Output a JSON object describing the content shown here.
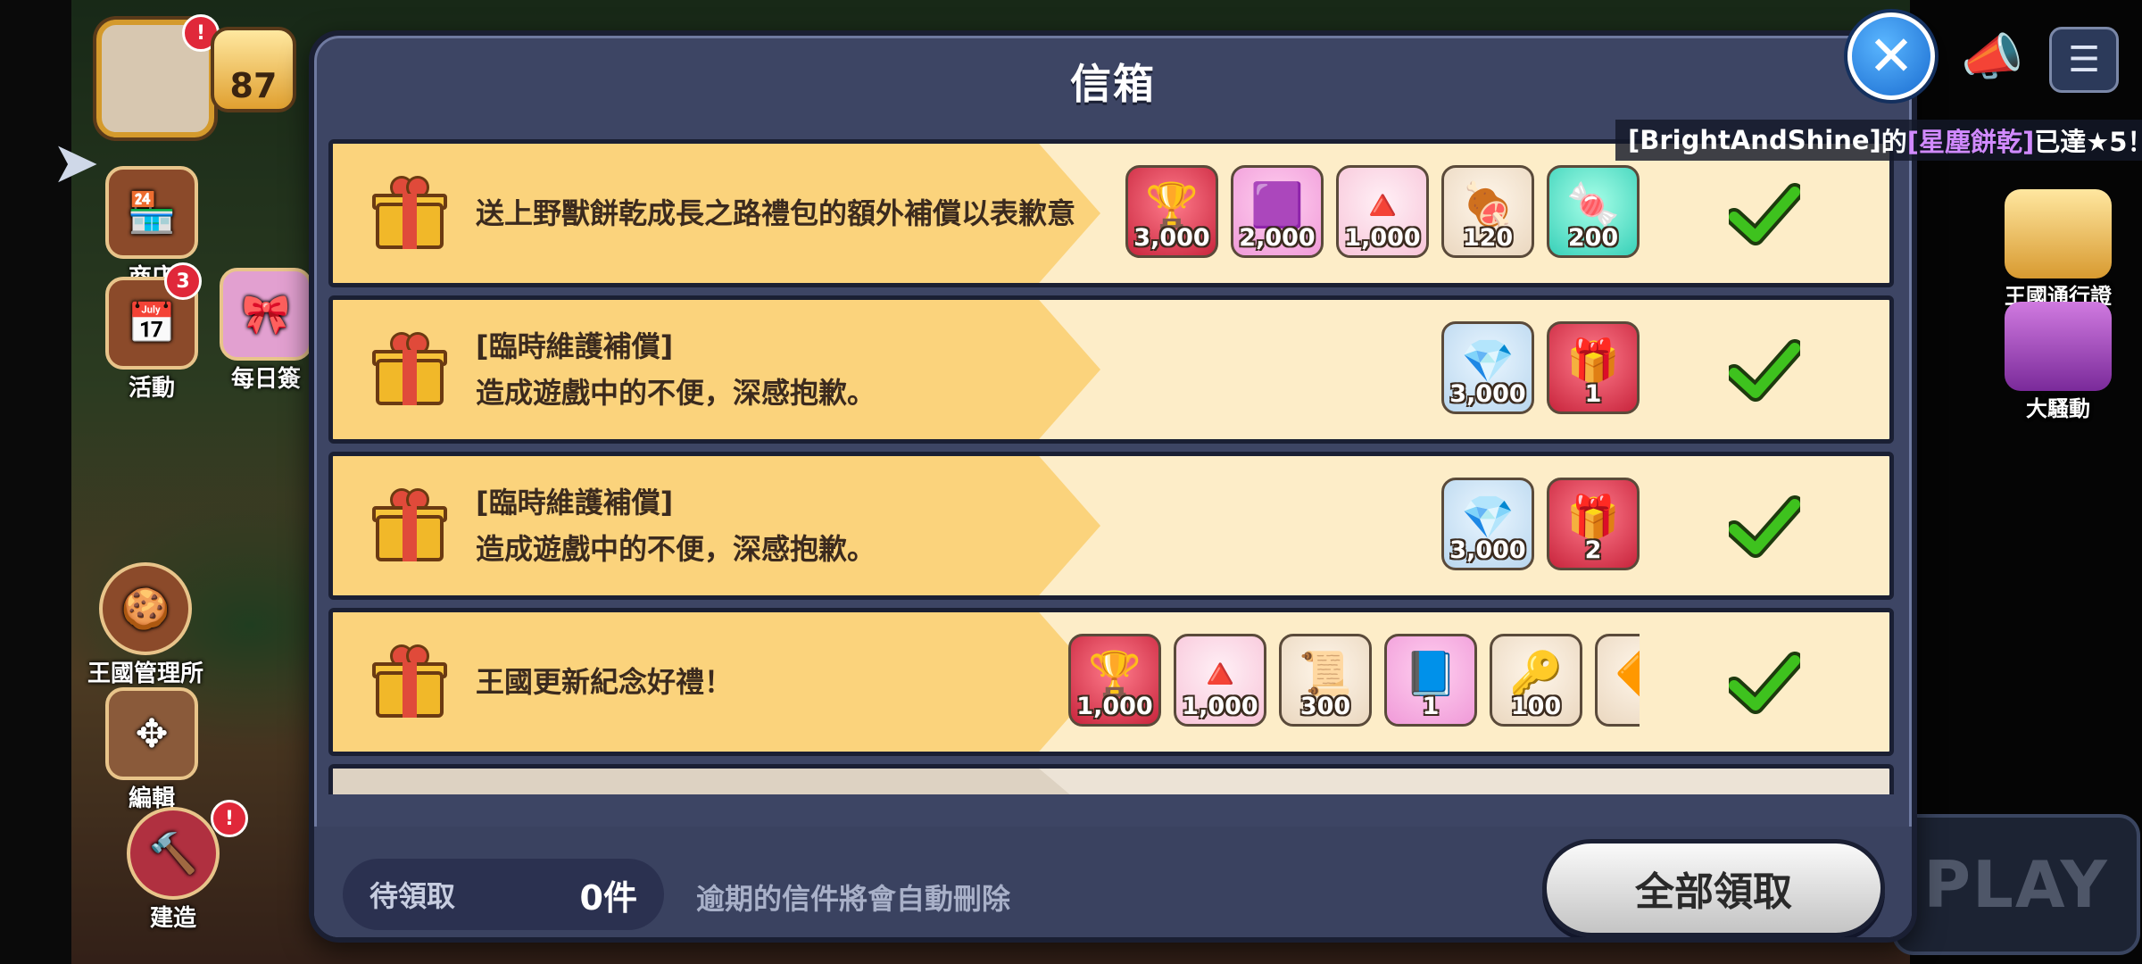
{
  "hud": {
    "level": "87",
    "shop_label": "商店",
    "events_label": "活動",
    "events_badge": "3",
    "daily_label": "每日簽",
    "kingdom_mgmt_label": "王國管理所",
    "edit_label": "編輯",
    "build_label": "建造",
    "kingdom_pass_label": "王國通行證",
    "commotion_label": "大騷動",
    "play_label": "PLAY",
    "alert_badge": "!"
  },
  "notice": {
    "player": "[BrightAndShine]",
    "mid": "的",
    "cookie": "[星塵餅乾]",
    "suffix": "已達★5！"
  },
  "mailbox": {
    "title": "信箱",
    "mails": [
      {
        "lines": [
          "送上野獸餅乾成長之路禮包的額外補償以表歉意"
        ],
        "rewards": [
          {
            "icon": "crystal-chest-icon",
            "glyph": "🏆",
            "bg": "red",
            "qty": "3,000"
          },
          {
            "icon": "rainbow-cube-icon",
            "glyph": "🟪",
            "bg": "purple",
            "qty": "2,000"
          },
          {
            "icon": "sugar-gnome-icon",
            "glyph": "🔺",
            "bg": "pink",
            "qty": "1,000"
          },
          {
            "icon": "meat-icon",
            "glyph": "🍖",
            "bg": "beige",
            "qty": "120"
          },
          {
            "icon": "jelly-icon",
            "glyph": "🍬",
            "bg": "teal",
            "qty": "200"
          }
        ]
      },
      {
        "lines": [
          "[臨時維護補償]",
          "造成遊戲中的不便，深感抱歉。"
        ],
        "rewards": [
          {
            "icon": "crystal-icon",
            "glyph": "💎",
            "bg": "blue",
            "qty": "3,000"
          },
          {
            "icon": "treasure-ticket-icon",
            "glyph": "🎁",
            "bg": "red",
            "qty": "1"
          }
        ]
      },
      {
        "lines": [
          "[臨時維護補償]",
          "造成遊戲中的不便，深感抱歉。"
        ],
        "rewards": [
          {
            "icon": "crystal-icon",
            "glyph": "💎",
            "bg": "blue",
            "qty": "3,000"
          },
          {
            "icon": "treasure-ticket-icon",
            "glyph": "🎁",
            "bg": "red",
            "qty": "2"
          }
        ]
      },
      {
        "lines": [
          "王國更新紀念好禮！"
        ],
        "rewards": [
          {
            "icon": "crystal-chest-icon",
            "glyph": "🏆",
            "bg": "red",
            "qty": "1,000"
          },
          {
            "icon": "sugar-gnome-icon",
            "glyph": "🔺",
            "bg": "pink",
            "qty": "1,000"
          },
          {
            "icon": "scroll-icon",
            "glyph": "📜",
            "bg": "beige",
            "qty": "300"
          },
          {
            "icon": "blue-scroll-icon",
            "glyph": "📘",
            "bg": "purple",
            "qty": "1"
          },
          {
            "icon": "magic-key-icon",
            "glyph": "🔑",
            "bg": "beige",
            "qty": "100"
          },
          {
            "icon": "partial-item-icon",
            "glyph": "🔶",
            "bg": "beige",
            "qty": ""
          }
        ]
      }
    ],
    "pending_label": "待領取",
    "pending_count": "0件",
    "expire_note": "逾期的信件將會自動刪除",
    "claim_all_label": "全部領取"
  },
  "colors": {
    "band": "#fbd37c",
    "mail_bg": "#fdedc8",
    "modal_bg": "#3d4564",
    "check": "#3ec21e"
  }
}
